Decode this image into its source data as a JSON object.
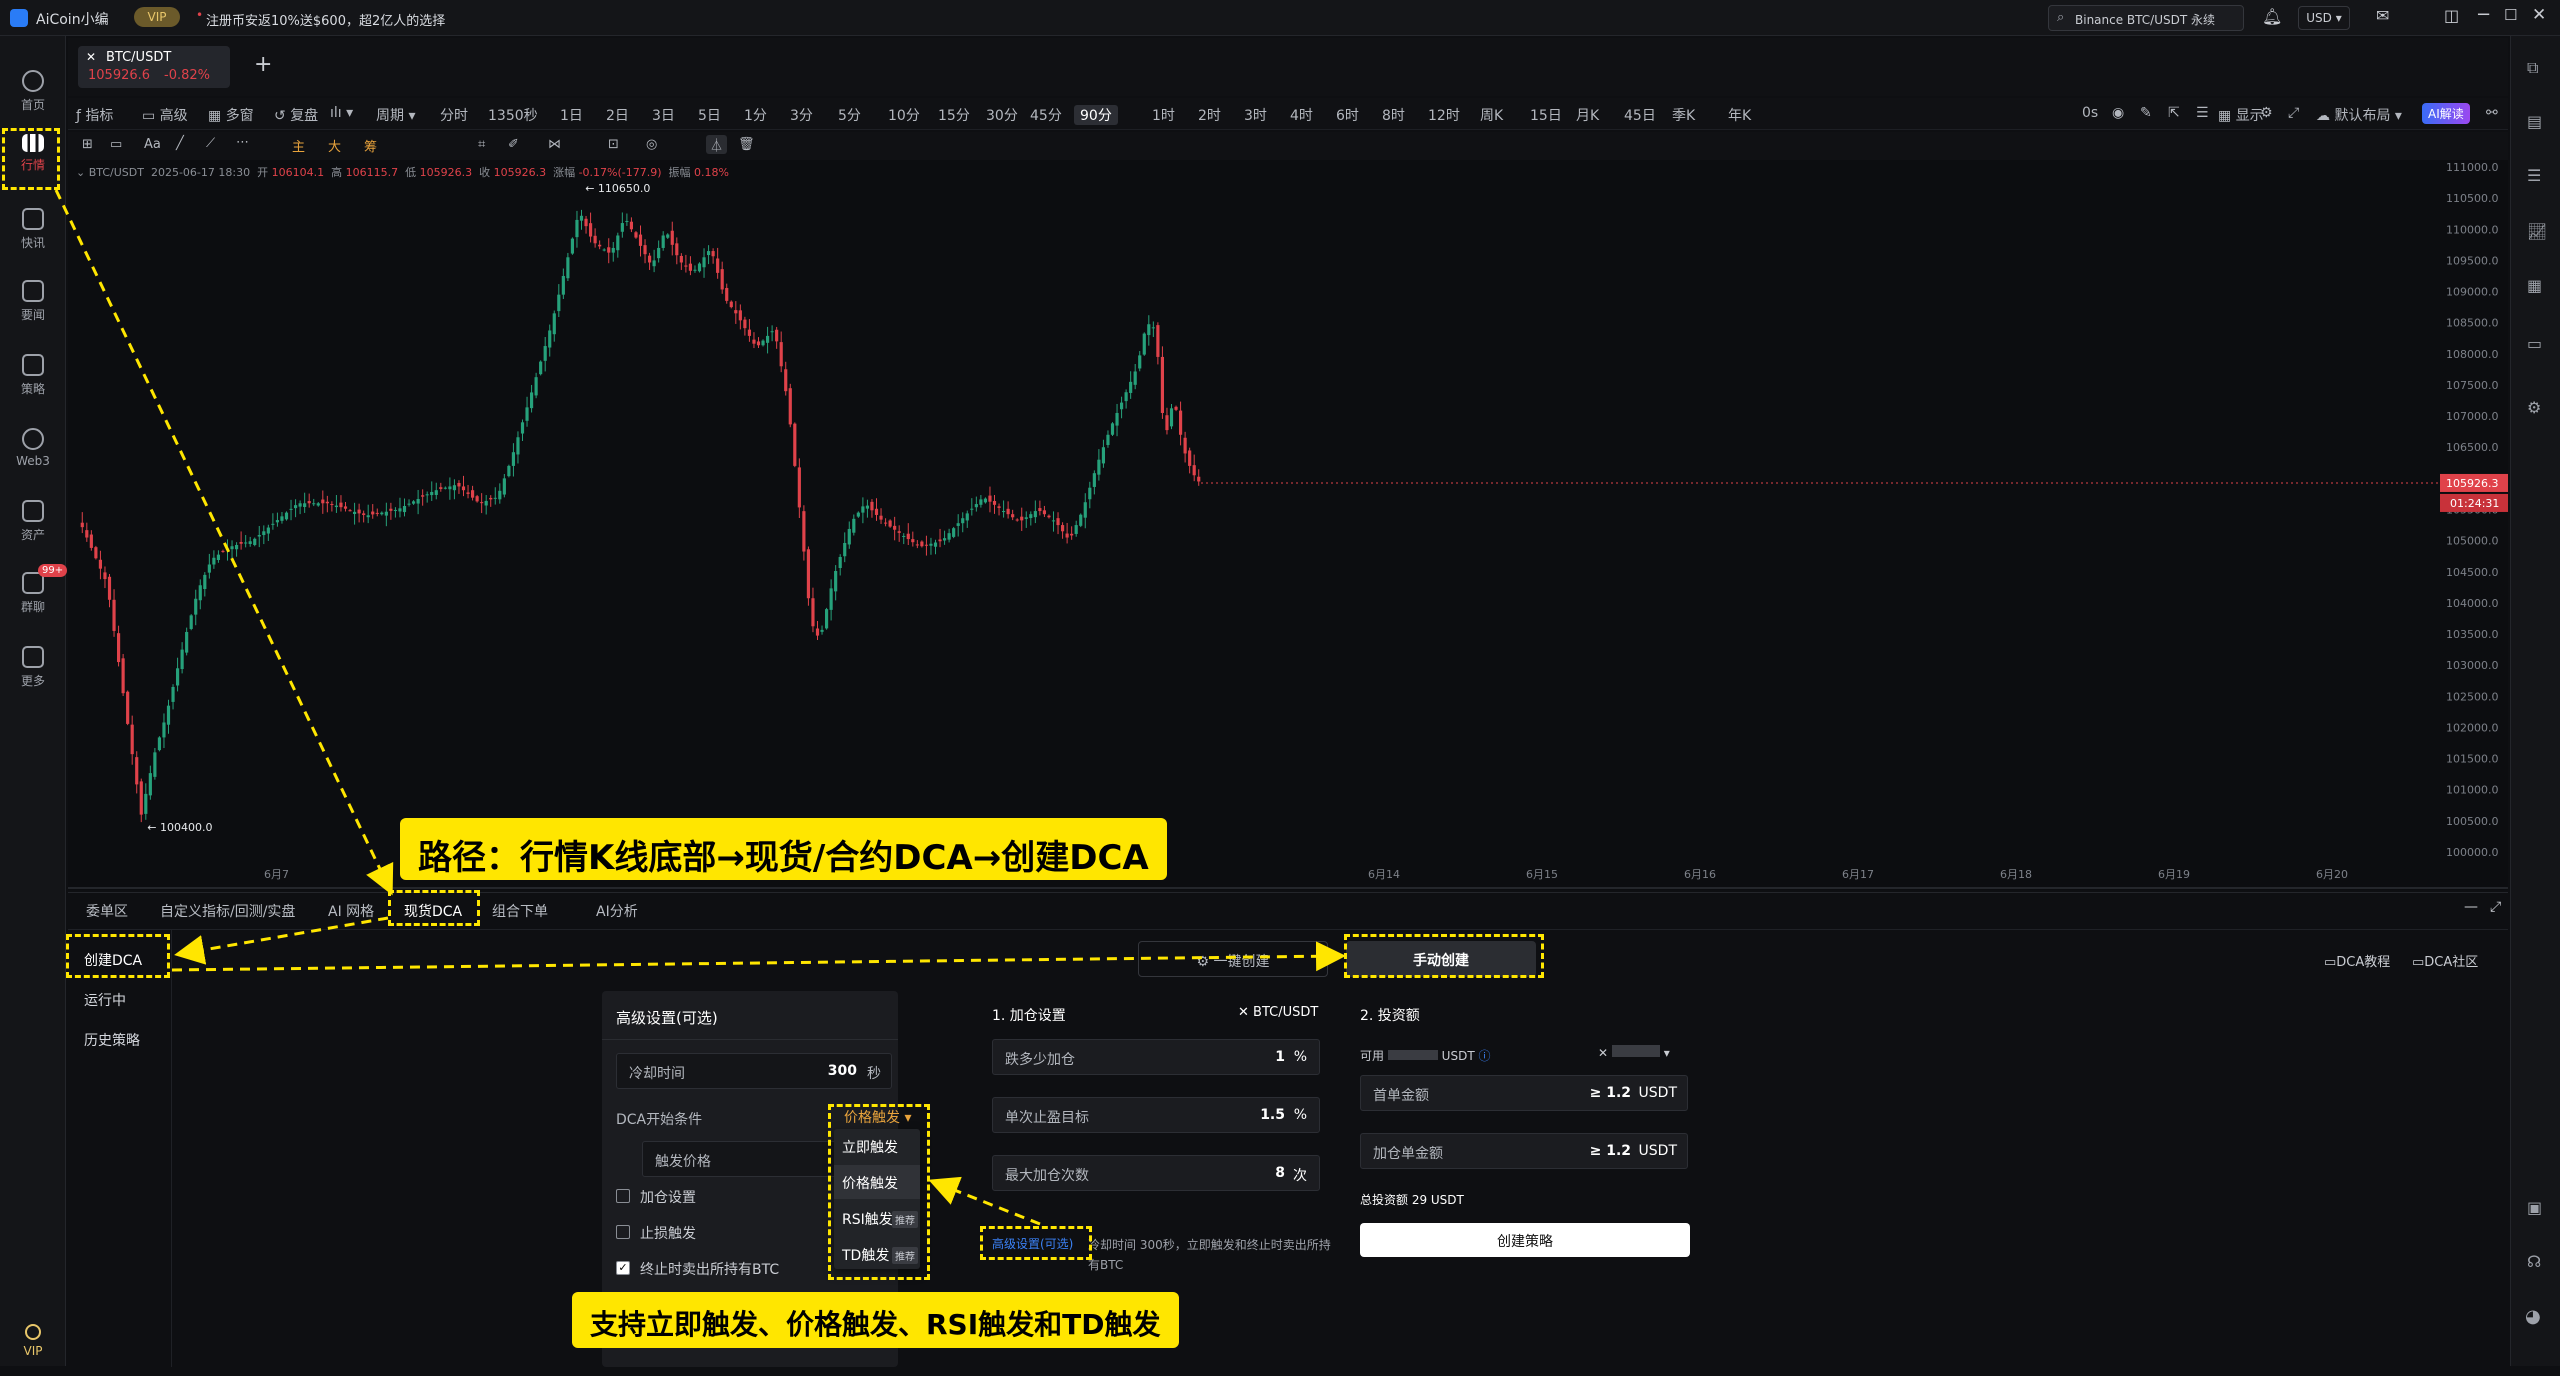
{
  "titlebar": {
    "app_name": "AiCoin小编",
    "vip_label": "VIP",
    "promo": "注册币安返10%送$600，超2亿人的选择",
    "search": "Binance BTC/USDT 永续",
    "currency": "USD"
  },
  "leftnav": {
    "items": [
      {
        "label": "首页",
        "icon": "home-icon"
      },
      {
        "label": "行情",
        "icon": "market-icon"
      },
      {
        "label": "快讯",
        "icon": "news-icon"
      },
      {
        "label": "要闻",
        "icon": "headline-icon"
      },
      {
        "label": "策略",
        "icon": "strategy-icon"
      },
      {
        "label": "Web3",
        "icon": "web3-icon"
      },
      {
        "label": "资产",
        "icon": "assets-icon"
      },
      {
        "label": "群聊",
        "icon": "chat-icon"
      },
      {
        "label": "更多",
        "icon": "more-icon"
      }
    ],
    "chat_badge": "99+",
    "vip": "VIP"
  },
  "symbol_tab": {
    "name": "BTC/USDT",
    "price": "105926.6",
    "change": "-0.82%",
    "add": "+"
  },
  "toolbar": {
    "left": [
      "指标",
      "高级",
      "多窗",
      "复盘"
    ],
    "period_label": "周期",
    "periods": [
      "分时",
      "1350秒",
      "1日",
      "2日",
      "3日",
      "5日",
      "1分",
      "3分",
      "5分",
      "10分",
      "15分",
      "30分",
      "45分",
      "90分",
      "1时",
      "2时",
      "3时",
      "4时",
      "6时",
      "8时",
      "12时",
      "周K",
      "15日",
      "月K",
      "45日",
      "季K",
      "年K"
    ],
    "active_period": "90分",
    "right": [
      "0s",
      "显示",
      "默认布局",
      "AI解读"
    ]
  },
  "drawbar": {
    "labels": [
      "Aa",
      "主",
      "大",
      "筹"
    ]
  },
  "ohlc": {
    "symbol": "BTC/USDT",
    "time": "2025-06-17 18:30",
    "open_label": "开",
    "open": "106104.1",
    "high_label": "高",
    "high": "106115.7",
    "low_label": "低",
    "low": "105926.3",
    "close_label": "收",
    "close": "105926.3",
    "chg_label": "涨幅",
    "chg": "-0.17%(-177.9)",
    "amp_label": "振幅",
    "amp": "0.18%"
  },
  "chart_data": {
    "type": "candlestick",
    "y_ticks": [
      "111000.0",
      "110500.0",
      "110000.0",
      "109500.0",
      "109000.0",
      "108500.0",
      "108000.0",
      "107500.0",
      "107000.0",
      "106500.0",
      "106000.0",
      "105500.0",
      "105000.0",
      "104500.0",
      "104000.0",
      "103500.0",
      "103000.0",
      "102500.0",
      "102000.0",
      "101500.0",
      "101000.0",
      "100500.0",
      "100000.0"
    ],
    "x_ticks": [
      "6月7",
      "6月14",
      "6月15",
      "6月16",
      "6月17",
      "6月18",
      "6月19",
      "6月20"
    ],
    "high_marker": "110650.0",
    "low_marker": "100400.0",
    "last_price": "105926.3",
    "countdown": "01:24:31",
    "ylim": [
      100000,
      111000
    ]
  },
  "panel": {
    "tabs": [
      "委单区",
      "自定义指标/回测/实盘",
      "AI 网格",
      "现货DCA",
      "组合下单",
      "AI分析"
    ],
    "active_tab": "现货DCA",
    "side": [
      "创建DCA",
      "运行中",
      "历史策略"
    ],
    "mode_one_click": "一键创建",
    "mode_manual": "手动创建",
    "links": [
      "DCA教程",
      "DCA社区"
    ],
    "advanced": {
      "title": "高级设置(可选)",
      "cooldown_label": "冷却时间",
      "cooldown_value": "300",
      "cooldown_unit": "秒",
      "start_label": "DCA开始条件",
      "trigger_selected": "价格触发",
      "trigger_options": [
        "立即触发",
        "价格触发",
        "RSI触发",
        "TD触发"
      ],
      "recommend": "推荐",
      "trigger_price": "触发价格",
      "add_setting": "加仓设置",
      "stop_loss": "止损触发",
      "sell_all": "终止时卖出所持有BTC"
    },
    "add_settings": {
      "title": "1. 加仓设置",
      "pair": "BTC/USDT",
      "drop_label": "跌多少加仓",
      "drop_value": "1",
      "drop_unit": "%",
      "tp_label": "单次止盈目标",
      "tp_value": "1.5",
      "tp_unit": "%",
      "max_label": "最大加仓次数",
      "max_value": "8",
      "max_unit": "次",
      "adv_link": "高级设置(可选)",
      "adv_desc": "冷却时间 300秒，立即触发和终止时卖出所持有BTC"
    },
    "invest": {
      "title": "2. 投资额",
      "available_label": "可用",
      "available_unit": "USDT",
      "first_label": "首单金额",
      "first_value": "≥ 1.2",
      "first_unit": "USDT",
      "add_label": "加仓单金额",
      "add_value": "≥ 1.2",
      "add_unit": "USDT",
      "total": "总投资额 29 USDT",
      "create": "创建策略"
    }
  },
  "annotations": {
    "path": "路径：行情K线底部→现货/合约DCA→创建DCA",
    "triggers": "支持立即触发、价格触发、RSI触发和TD触发"
  },
  "colors": {
    "up": "#26a17b",
    "down": "#e0424a",
    "accent": "#ffe600",
    "bg": "#0c0d10"
  }
}
